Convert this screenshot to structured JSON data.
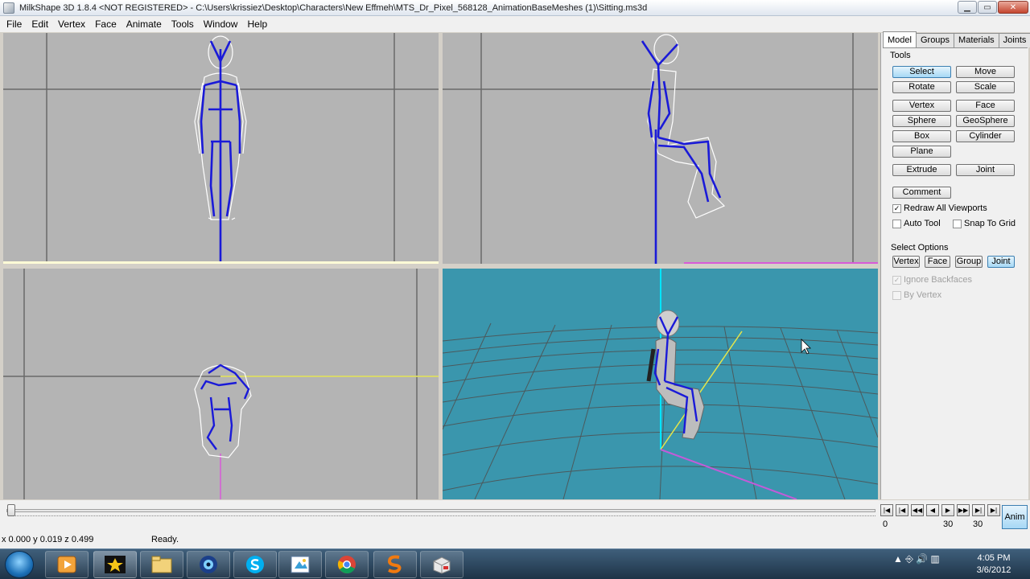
{
  "window": {
    "title": "MilkShape 3D 1.8.4 <NOT REGISTERED> - C:\\Users\\krissiez\\Desktop\\Characters\\New Effmeh\\MTS_Dr_Pixel_568128_AnimationBaseMeshes (1)\\Sitting.ms3d",
    "minimize": "▁",
    "maximize": "▭",
    "close": "✕"
  },
  "menu": [
    "File",
    "Edit",
    "Vertex",
    "Face",
    "Animate",
    "Tools",
    "Window",
    "Help"
  ],
  "panel": {
    "tabs": [
      "Model",
      "Groups",
      "Materials",
      "Joints"
    ],
    "active_tab": "Model",
    "tools_label": "Tools",
    "tools": {
      "select": "Select",
      "move": "Move",
      "rotate": "Rotate",
      "scale": "Scale",
      "vertex": "Vertex",
      "face": "Face",
      "sphere": "Sphere",
      "geosphere": "GeoSphere",
      "box": "Box",
      "cylinder": "Cylinder",
      "plane": "Plane",
      "extrude": "Extrude",
      "joint": "Joint",
      "comment": "Comment"
    },
    "redraw_all": "Redraw All Viewports",
    "auto_tool": "Auto Tool",
    "snap_to_grid": "Snap To Grid",
    "select_options_label": "Select Options",
    "select_options": {
      "vertex": "Vertex",
      "face": "Face",
      "group": "Group",
      "joint": "Joint"
    },
    "ignore_backfaces": "Ignore Backfaces",
    "by_vertex": "By Vertex",
    "check_mark": "✓"
  },
  "timeline": {
    "nav": [
      "|◀",
      "|◀",
      "◀◀",
      "◀",
      "▶",
      "▶▶",
      "▶|",
      "▶|"
    ],
    "current_frame": "0",
    "frame_a": "30",
    "frame_b": "30",
    "anim_label": "Anim"
  },
  "status": {
    "coords": "x 0.000 y 0.019 z 0.499",
    "message": "Ready."
  },
  "tray": {
    "icons": "▲  ⎆  🔊  ▥",
    "time": "4:05 PM",
    "date": "3/6/2012"
  },
  "icons": {
    "start": "windows-orb-icon",
    "tasks": [
      "media-player-icon",
      "movie-maker-icon",
      "file-explorer-icon",
      "camera-app-icon",
      "skype-icon",
      "paint-icon",
      "chrome-icon",
      "sims-icon",
      "package-icon"
    ]
  }
}
